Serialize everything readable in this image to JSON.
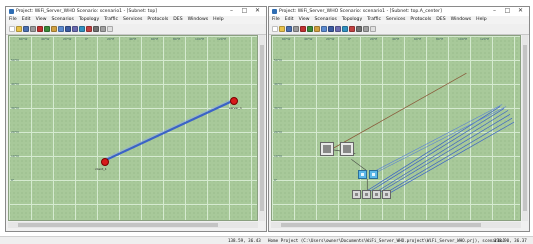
{
  "left_window": {
    "title": "Project: WiFi_Server_WHO Scenario: scenario1 - [Subnet: top]",
    "window_buttons": [
      "–",
      "□",
      "✕"
    ],
    "menu": [
      "File",
      "Edit",
      "View",
      "Scenarios",
      "Topology",
      "Traffic",
      "Services",
      "Protocols",
      "DES",
      "Windows",
      "Help"
    ],
    "lat_labels": [
      "50°N",
      "40°N",
      "30°N",
      "20°N",
      "10°N",
      "0°"
    ],
    "lon_labels": [
      "60°W",
      "40°W",
      "20°W",
      "0°",
      "20°E",
      "40°E",
      "60°E",
      "80°E",
      "100°E",
      "120°E"
    ],
    "nodes": [
      {
        "label": "server_1"
      },
      {
        "label": "client_1"
      }
    ]
  },
  "right_window": {
    "title": "Project: WiFi_Server_WHO Scenario: scenario1 - [Subnet: top.A_center]",
    "window_buttons": [
      "–",
      "□",
      "✕"
    ],
    "menu": [
      "File",
      "Edit",
      "View",
      "Scenarios",
      "Topology",
      "Traffic",
      "Services",
      "Protocols",
      "DES",
      "Windows",
      "Help"
    ],
    "lat_labels": [
      "50°N",
      "40°N",
      "30°N",
      "20°N",
      "10°N",
      "0°"
    ],
    "lon_labels": [
      "60°W",
      "40°W",
      "20°W",
      "0°",
      "20°E",
      "40°E",
      "60°E",
      "80°E",
      "100°E",
      "120°E"
    ]
  },
  "status": {
    "left_coords": "138.59, 36.43",
    "message": "Home Project (C:\\Users\\owner\\Documents\\WiFi_Server_WHO.project\\WiFi_Server_WHO.prj), scenario1",
    "right_coords": "138.90, 36.37"
  },
  "colors": {
    "map_bg": "#a8c99a",
    "red_node": "#d61a1a",
    "blue_link": "#3a62c8",
    "brown_link": "#8a5a3a"
  },
  "toolbar_icons": [
    "new-icon",
    "open-icon",
    "save-icon",
    "print-icon",
    "cut-icon",
    "copy-icon",
    "paste-icon",
    "zoom-in-icon",
    "zoom-out-icon",
    "pan-icon",
    "run-icon",
    "stop-icon",
    "results-icon",
    "config-icon",
    "help-icon"
  ]
}
